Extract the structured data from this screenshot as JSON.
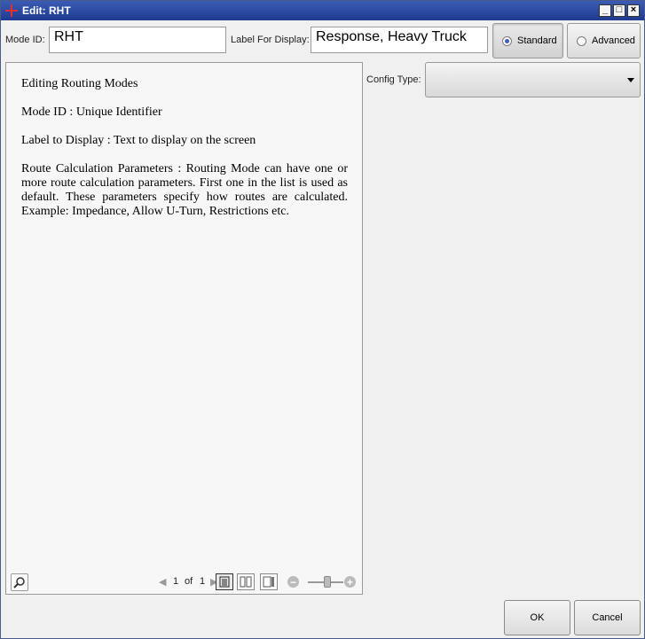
{
  "window": {
    "title": "Edit: RHT",
    "controls": {
      "minimize": "_",
      "maximize": "□",
      "close": "×"
    }
  },
  "form": {
    "mode_id_label": "Mode ID:",
    "mode_id_value": "RHT",
    "display_label": "Label For Display:",
    "display_value": "Response, Heavy Truck",
    "standard_label": "Standard",
    "advanced_label": "Advanced",
    "selected_mode": "Standard"
  },
  "document": {
    "paragraphs": [
      "Editing Routing Modes",
      "Mode ID : Unique Identifier",
      "Label to Display : Text to display on the screen",
      "Route Calculation Parameters : Routing Mode can have one or more route calculation parameters. First one in the list is used as default. These parameters specify how routes are calculated. Example: Impedance, Allow U-Turn, Restrictions etc."
    ],
    "toolbar": {
      "page_current": "1",
      "page_of": "of",
      "page_total": "1"
    }
  },
  "config": {
    "label": "Config Type:",
    "value": ""
  },
  "footer": {
    "ok_label": "OK",
    "cancel_label": "Cancel"
  },
  "icons": [
    "app-icon",
    "search-icon",
    "page-prev-icon",
    "page-next-icon",
    "single-page-view-icon",
    "two-page-view-icon",
    "continuous-view-icon",
    "zoom-out-icon",
    "zoom-in-icon",
    "dropdown-arrow-icon"
  ],
  "colors": {
    "titlebar": "#1f3a8f",
    "radio_selected": "#3a5fb8",
    "app_icon": "#e03030"
  }
}
